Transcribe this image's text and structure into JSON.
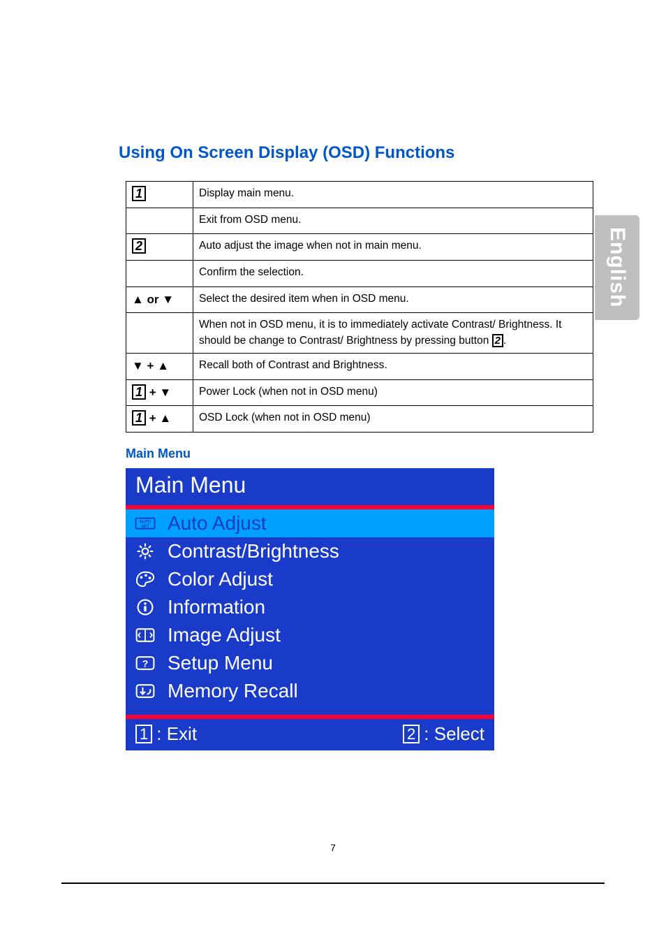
{
  "side_tab": "English",
  "section_title": "Using On Screen Display (OSD) Functions",
  "table": {
    "rows": [
      {
        "key_type": "box",
        "key": "1",
        "desc": "Display main menu."
      },
      {
        "key_type": "empty",
        "key": "",
        "desc": "Exit from OSD menu."
      },
      {
        "key_type": "box",
        "key": "2",
        "desc": "Auto adjust the image when not in main menu."
      },
      {
        "key_type": "empty",
        "key": "",
        "desc": "Confirm the selection."
      },
      {
        "key_type": "text",
        "key": "▲ or ▼",
        "desc": "Select the desired item when in OSD menu."
      },
      {
        "key_type": "empty",
        "key": "",
        "desc_pre": "When not in OSD menu, it is to immediately activate Contrast/ Brightness. It should be change to Contrast/ Brightness by pressing button ",
        "desc_box": "2",
        "desc_post": "."
      },
      {
        "key_type": "text",
        "key": "▼ + ▲",
        "desc": "Recall both of Contrast and Brightness."
      },
      {
        "key_type": "box_plus",
        "key": "1",
        "suffix": " + ▼",
        "desc": "Power Lock (when not in OSD menu)"
      },
      {
        "key_type": "box_plus",
        "key": "1",
        "suffix": " + ▲",
        "desc": "OSD Lock (when not in OSD menu)"
      }
    ]
  },
  "sub_title": "Main Menu",
  "osd": {
    "title": "Main Menu",
    "items": [
      {
        "icon": "auto-set",
        "label": "Auto Adjust",
        "selected": true
      },
      {
        "icon": "sun",
        "label": "Contrast/Brightness",
        "selected": false
      },
      {
        "icon": "palette",
        "label": "Color Adjust",
        "selected": false
      },
      {
        "icon": "info",
        "label": "Information",
        "selected": false
      },
      {
        "icon": "image",
        "label": "Image Adjust",
        "selected": false
      },
      {
        "icon": "question",
        "label": "Setup Menu",
        "selected": false
      },
      {
        "icon": "recall",
        "label": "Memory Recall",
        "selected": false
      }
    ],
    "footer_left_num": "1",
    "footer_left": ": Exit",
    "footer_right_num": "2",
    "footer_right": ": Select"
  },
  "page_number": "7"
}
